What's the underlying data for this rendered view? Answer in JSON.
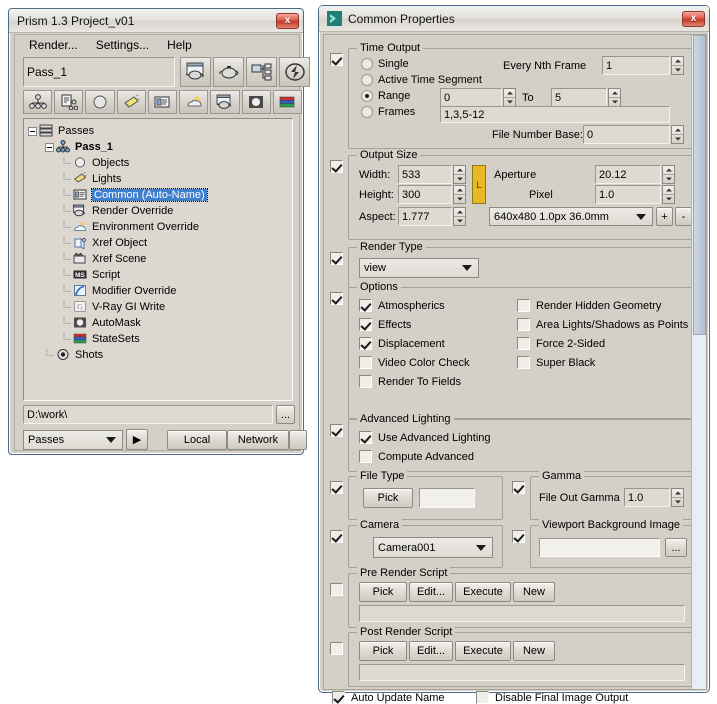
{
  "prism": {
    "title": "Prism 1.3   Project_v01",
    "close_label": "x",
    "menu": [
      "Render...",
      "Settings...",
      "Help"
    ],
    "pass_name_field": "Pass_1",
    "toolbar_top_icons": [
      "render-pass-icon",
      "teapot-icon",
      "network-tree-icon",
      "flash-icon"
    ],
    "toolbar_bottom_icons": [
      "hierarchy-icon",
      "objects-icon",
      "sphere-icon",
      "light-icon",
      "common-properties-icon",
      "environment-icon",
      "render-override-icon",
      "automask-icon",
      "statesets-icon"
    ],
    "tree": [
      {
        "label": "Passes",
        "depth": 0,
        "icon": "passes-icon",
        "expander": true,
        "bold": false,
        "selected": false
      },
      {
        "label": "Pass_1",
        "depth": 1,
        "icon": "pass-node-icon",
        "expander": true,
        "bold": true,
        "selected": false
      },
      {
        "label": "Objects",
        "depth": 2,
        "icon": "sphere-icon",
        "expander": false,
        "bold": false,
        "selected": false
      },
      {
        "label": "Lights",
        "depth": 2,
        "icon": "light-icon",
        "expander": false,
        "bold": false,
        "selected": false
      },
      {
        "label": "Common (Auto-Name)",
        "depth": 2,
        "icon": "common-properties-icon",
        "expander": false,
        "bold": false,
        "selected": true
      },
      {
        "label": "Render Override",
        "depth": 2,
        "icon": "render-override-icon",
        "expander": false,
        "bold": false,
        "selected": false
      },
      {
        "label": "Environment Override",
        "depth": 2,
        "icon": "environment-icon",
        "expander": false,
        "bold": false,
        "selected": false
      },
      {
        "label": "Xref Object",
        "depth": 2,
        "icon": "xref-object-icon",
        "expander": false,
        "bold": false,
        "selected": false
      },
      {
        "label": "Xref Scene",
        "depth": 2,
        "icon": "xref-scene-icon",
        "expander": false,
        "bold": false,
        "selected": false
      },
      {
        "label": "Script",
        "depth": 2,
        "icon": "maxscript-icon",
        "expander": false,
        "bold": false,
        "selected": false
      },
      {
        "label": "Modifier Override",
        "depth": 2,
        "icon": "modifier-override-icon",
        "expander": false,
        "bold": false,
        "selected": false
      },
      {
        "label": "V-Ray GI Write",
        "depth": 2,
        "icon": "vray-gi-write-icon",
        "expander": false,
        "bold": false,
        "selected": false
      },
      {
        "label": "AutoMask",
        "depth": 2,
        "icon": "automask-icon",
        "expander": false,
        "bold": false,
        "selected": false
      },
      {
        "label": "StateSets",
        "depth": 2,
        "icon": "statesets-icon",
        "expander": false,
        "bold": false,
        "selected": false
      },
      {
        "label": "Shots",
        "depth": 1,
        "icon": "shots-icon",
        "expander": false,
        "bold": false,
        "selected": false
      }
    ],
    "path_field": "D:\\work\\",
    "browse_label": "...",
    "scope_combo": "Passes",
    "play_label": "▶",
    "local_label": "Local",
    "network_label": "Network",
    "more_label": "▼"
  },
  "dialog": {
    "title": "Common Properties",
    "close_label": "x",
    "time_output": {
      "enabled": true,
      "legend": "Time Output",
      "options": [
        "Single",
        "Active Time Segment",
        "Range",
        "Frames"
      ],
      "selected": "Range",
      "every_nth_frame_label": "Every Nth Frame",
      "every_nth_frame_value": "1",
      "range_from": "0",
      "to_label": "To",
      "range_to": "5",
      "frames_value": "1,3,5-12",
      "file_number_base_label": "File Number Base:",
      "file_number_base_value": "0"
    },
    "output_size": {
      "enabled": true,
      "legend": "Output Size",
      "width_label": "Width:",
      "width_value": "533",
      "height_label": "Height:",
      "height_value": "300",
      "aspect_label": "Aspect:",
      "aspect_value": "1.777",
      "lock_label": "L",
      "aperture_label": "Aperture",
      "aperture_value": "20.12",
      "pixel_label": "Pixel",
      "pixel_value": "1.0",
      "preset_combo": "640x480 1.0px 36.0mm",
      "plus_label": "+",
      "minus_label": "-"
    },
    "render_type": {
      "enabled": true,
      "legend": "Render Type",
      "value": "view"
    },
    "options": {
      "enabled": true,
      "legend": "Options",
      "left": [
        {
          "label": "Atmospherics",
          "checked": true
        },
        {
          "label": "Effects",
          "checked": true
        },
        {
          "label": "Displacement",
          "checked": true
        },
        {
          "label": "Video Color Check",
          "checked": false
        },
        {
          "label": "Render To Fields",
          "checked": false
        }
      ],
      "right": [
        {
          "label": "Render Hidden Geometry",
          "checked": false
        },
        {
          "label": "Area Lights/Shadows as Points",
          "checked": false
        },
        {
          "label": "Force 2-Sided",
          "checked": false
        },
        {
          "label": "Super Black",
          "checked": false
        }
      ]
    },
    "advanced_lighting": {
      "enabled": true,
      "legend": "Advanced Lighting",
      "items": [
        {
          "label": "Use Advanced Lighting",
          "checked": true
        },
        {
          "label": "Compute Advanced",
          "checked": false
        }
      ]
    },
    "file_type": {
      "enabled": true,
      "legend": "File Type",
      "pick_label": "Pick",
      "value": ""
    },
    "gamma": {
      "enabled": true,
      "legend": "Gamma",
      "file_out_gamma_label": "File Out Gamma",
      "file_out_gamma_value": "1.0"
    },
    "camera": {
      "enabled": true,
      "legend": "Camera",
      "value": "Camera001"
    },
    "viewport_background": {
      "enabled": true,
      "legend": "Viewport Background Image",
      "value": "",
      "browse_label": "..."
    },
    "pre_render_script": {
      "enabled": false,
      "legend": "Pre Render Script",
      "buttons": [
        "Pick",
        "Edit...",
        "Execute",
        "New"
      ],
      "value": ""
    },
    "post_render_script": {
      "enabled": false,
      "legend": "Post Render Script",
      "buttons": [
        "Pick",
        "Edit...",
        "Execute",
        "New"
      ],
      "value": ""
    },
    "footer": {
      "auto_update_name_label": "Auto Update Name",
      "auto_update_name_checked": true,
      "disable_final_image_label": "Disable Final Image Output",
      "disable_final_image_checked": false
    }
  },
  "colors": {
    "window_face": "#d4d0c8",
    "selection_blue": "#3f7fd0",
    "lock_yellow": "#e8b923",
    "title_border": "#4a6a8a"
  }
}
